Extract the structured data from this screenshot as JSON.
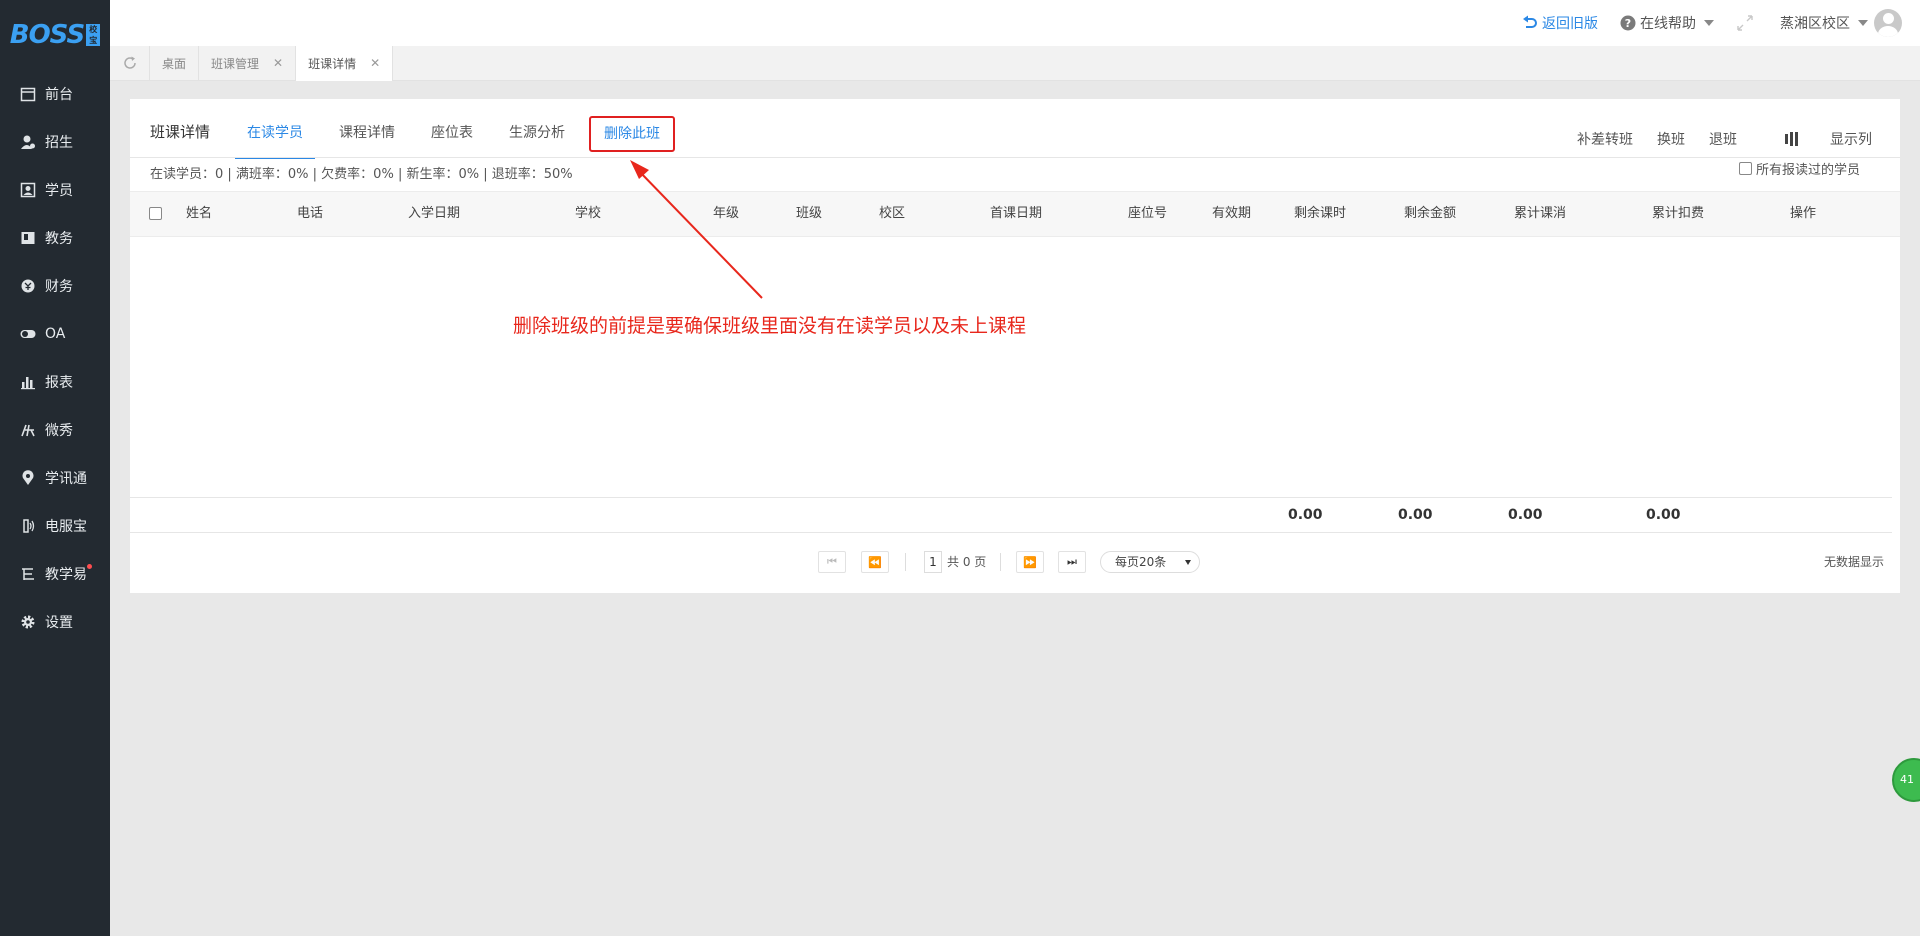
{
  "logo": {
    "text": "BOSS",
    "mark": "校宝"
  },
  "sidebar": {
    "items": [
      {
        "label": "前台",
        "icon": "calendar-icon"
      },
      {
        "label": "招生",
        "icon": "user-add-icon"
      },
      {
        "label": "学员",
        "icon": "student-card-icon"
      },
      {
        "label": "教务",
        "icon": "book-icon"
      },
      {
        "label": "财务",
        "icon": "money-icon"
      },
      {
        "label": "OA",
        "icon": "toggle-icon"
      },
      {
        "label": "报表",
        "icon": "chart-icon"
      },
      {
        "label": "微秀",
        "icon": "wx-icon"
      },
      {
        "label": "学讯通",
        "icon": "location-icon"
      },
      {
        "label": "电服宝",
        "icon": "phone-icon"
      },
      {
        "label": "教学易",
        "icon": "teach-icon"
      },
      {
        "label": "设置",
        "icon": "gear-icon"
      }
    ]
  },
  "topbar": {
    "back_label": "返回旧版",
    "help_label": "在线帮助",
    "campus_label": "蒸湘区校区"
  },
  "tabs": [
    {
      "label": "桌面"
    },
    {
      "label": "班课管理"
    },
    {
      "label": "班课详情"
    }
  ],
  "card": {
    "title": "班课详情",
    "subtabs": [
      "在读学员",
      "课程详情",
      "座位表",
      "生源分析",
      "删除此班"
    ],
    "actions": [
      "补差转班",
      "换班",
      "退班",
      "显示列"
    ],
    "stats": "在读学员：0 | 满班率：0% | 欠费率：0% | 新生率：0% | 退班率：50%",
    "all_students_label": "所有报读过的学员"
  },
  "table": {
    "columns": [
      "姓名",
      "电话",
      "入学日期",
      "学校",
      "年级",
      "班级",
      "校区",
      "首课日期",
      "座位号",
      "有效期",
      "剩余课时",
      "剩余金额",
      "累计课消",
      "累计扣费",
      "操作"
    ],
    "totals": [
      "0.00",
      "0.00",
      "0.00",
      "0.00"
    ]
  },
  "pager": {
    "page": "1",
    "total_text": "共 0 页",
    "page_size": "每页20条",
    "empty_text": "无数据显示"
  },
  "annotation": "删除班级的前提是要确保班级里面没有在读学员以及未上课程",
  "float_button": "41",
  "colors": {
    "accent": "#2b88e5",
    "sidebar": "#232a31",
    "annotation": "#e8271c"
  }
}
